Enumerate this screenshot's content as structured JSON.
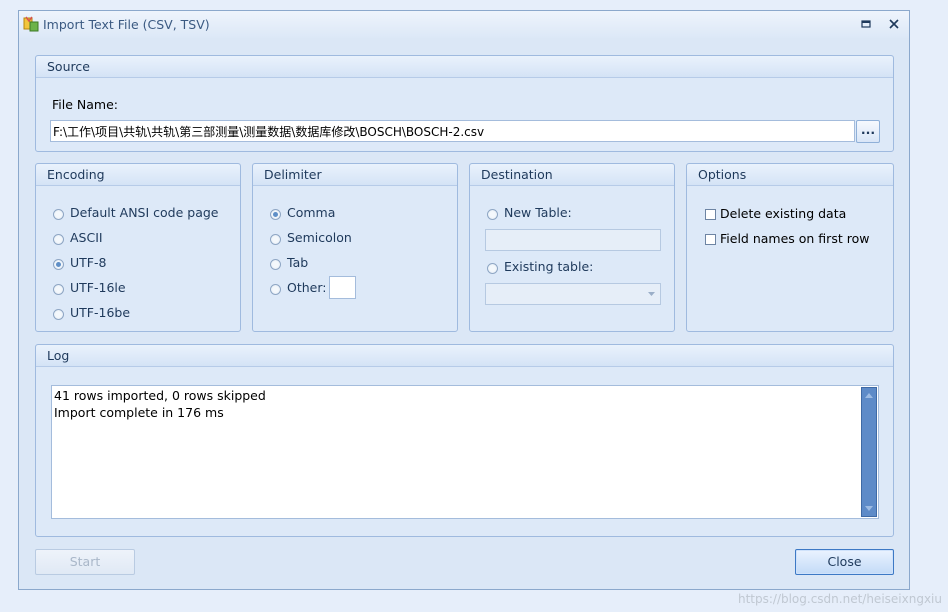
{
  "window": {
    "title": "Import Text File (CSV, TSV)",
    "icon": "import-app-icon",
    "controls": {
      "minimize_icon": "minimize-icon",
      "close_icon": "close-icon"
    }
  },
  "source": {
    "header": "Source",
    "file_name_label": "File Name:",
    "file_path": "F:\\工作\\项目\\共轨\\共轨\\第三部测量\\测量数据\\数据库修改\\BOSCH\\BOSCH-2.csv",
    "browse_label": "..."
  },
  "encoding": {
    "header": "Encoding",
    "options": [
      "Default ANSI code page",
      "ASCII",
      "UTF-8",
      "UTF-16le",
      "UTF-16be"
    ],
    "selected": "UTF-8"
  },
  "delimiter": {
    "header": "Delimiter",
    "options": [
      "Comma",
      "Semicolon",
      "Tab",
      "Other:"
    ],
    "selected": "Comma",
    "other_value": ""
  },
  "destination": {
    "header": "Destination",
    "new_table_label": "New Table:",
    "new_table_value": "",
    "existing_table_label": "Existing table:",
    "existing_table_value": ""
  },
  "options": {
    "header": "Options",
    "delete_existing_label": "Delete existing data",
    "delete_existing_checked": false,
    "field_names_label": "Field names on first row",
    "field_names_checked": false
  },
  "log": {
    "header": "Log",
    "lines": [
      "41 rows imported, 0 rows skipped",
      "Import complete in 176 ms"
    ]
  },
  "footer": {
    "start_label": "Start",
    "close_label": "Close"
  },
  "watermark": "https://blog.csdn.net/heiseixngxiu",
  "colors": {
    "accent": "#3d79c5",
    "window_bg": "#dbe7f6",
    "scrollbar": "#5e8bc8"
  }
}
